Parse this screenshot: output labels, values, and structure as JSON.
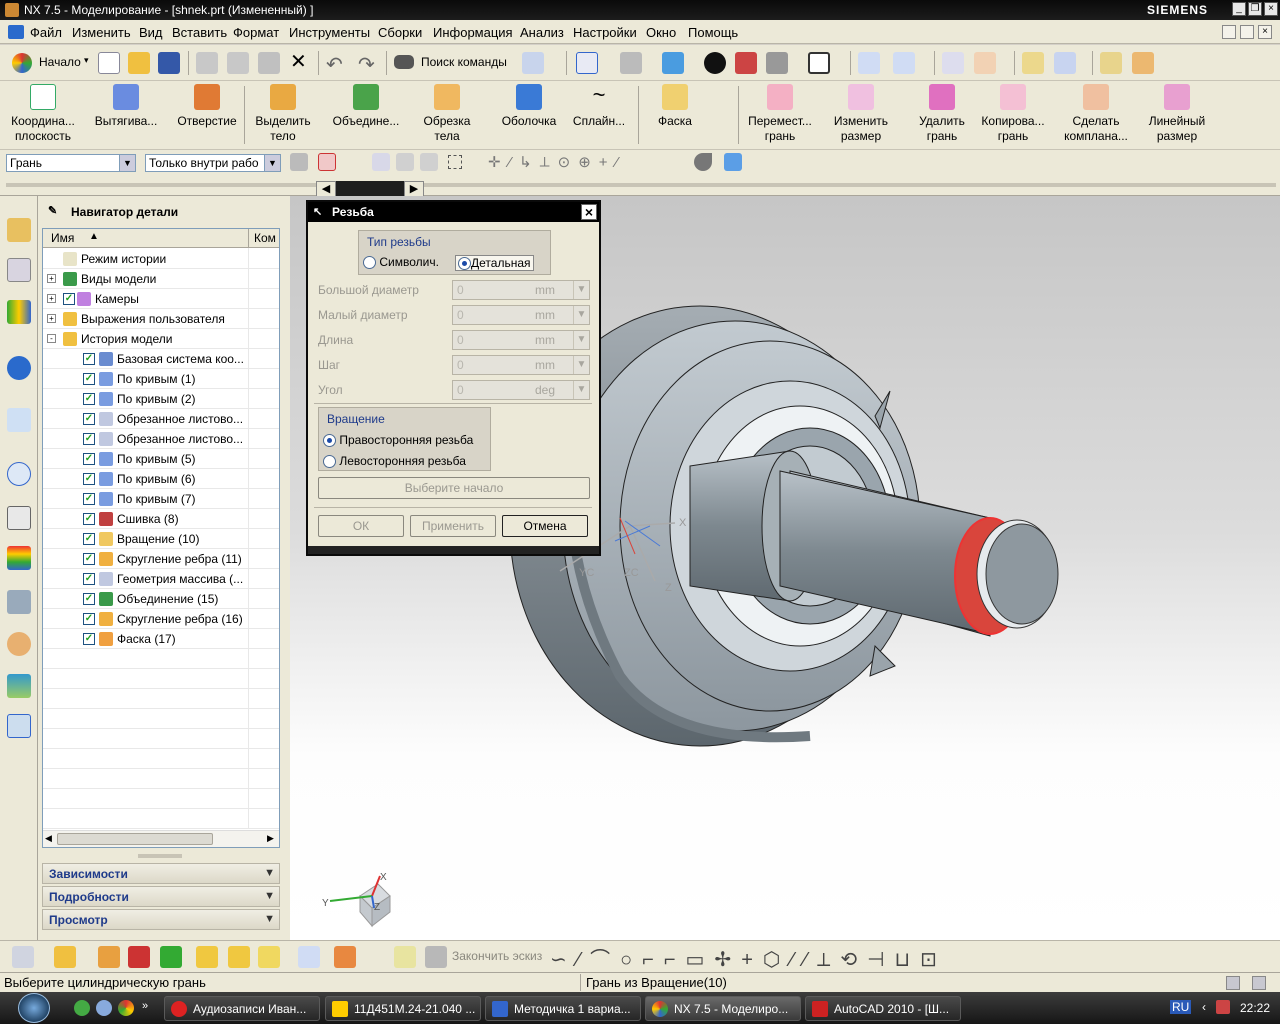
{
  "window": {
    "title": "NX 7.5 - Моделирование - [shnek.prt (Измененный) ]",
    "brand": "SIEMENS"
  },
  "menu": [
    "Файл",
    "Изменить",
    "Вид",
    "Вставить",
    "Формат",
    "Инструменты",
    "Сборки",
    "Информация",
    "Анализ",
    "Настройки",
    "Окно",
    "Помощь"
  ],
  "toolbar1": {
    "start_label": "Начало",
    "search_label": "Поиск команды"
  },
  "toolbar2": [
    {
      "label1": "Координа...",
      "label2": "плоскость"
    },
    {
      "label1": "Вытягива...",
      "label2": ""
    },
    {
      "label1": "Отверстие",
      "label2": ""
    },
    {
      "label1": "Выделить",
      "label2": "тело"
    },
    {
      "label1": "Объедине...",
      "label2": ""
    },
    {
      "label1": "Обрезка",
      "label2": "тела"
    },
    {
      "label1": "Оболочка",
      "label2": ""
    },
    {
      "label1": "Сплайн...",
      "label2": ""
    },
    {
      "label1": "Фаска",
      "label2": ""
    },
    {
      "label1": "Перемест...",
      "label2": "грань"
    },
    {
      "label1": "Изменить",
      "label2": "размер"
    },
    {
      "label1": "Удалить",
      "label2": "грань"
    },
    {
      "label1": "Копирова...",
      "label2": "грань"
    },
    {
      "label1": "Сделать",
      "label2": "комплана..."
    },
    {
      "label1": "Линейный",
      "label2": "размер"
    }
  ],
  "filters": {
    "type_filter": "Грань",
    "scope_filter": "Только внутри рабо"
  },
  "navigator": {
    "title": "Навигатор детали",
    "col_name": "Имя",
    "col_comment": "Ком",
    "items": [
      {
        "label": "Режим истории",
        "indent": 1,
        "check": false,
        "expand": ""
      },
      {
        "label": "Виды модели",
        "indent": 1,
        "check": false,
        "expand": "+"
      },
      {
        "label": "Камеры",
        "indent": 1,
        "check": true,
        "expand": "+"
      },
      {
        "label": "Выражения пользователя",
        "indent": 1,
        "check": false,
        "expand": "+"
      },
      {
        "label": "История модели",
        "indent": 1,
        "check": false,
        "expand": "-"
      },
      {
        "label": "Базовая система коо...",
        "indent": 2,
        "check": true,
        "expand": ""
      },
      {
        "label": "По кривым (1)",
        "indent": 2,
        "check": true,
        "expand": ""
      },
      {
        "label": "По кривым (2)",
        "indent": 2,
        "check": true,
        "expand": ""
      },
      {
        "label": "Обрезанное листово...",
        "indent": 2,
        "check": true,
        "expand": ""
      },
      {
        "label": "Обрезанное листово...",
        "indent": 2,
        "check": true,
        "expand": ""
      },
      {
        "label": "По кривым (5)",
        "indent": 2,
        "check": true,
        "expand": ""
      },
      {
        "label": "По кривым (6)",
        "indent": 2,
        "check": true,
        "expand": ""
      },
      {
        "label": "По кривым (7)",
        "indent": 2,
        "check": true,
        "expand": ""
      },
      {
        "label": "Сшивка (8)",
        "indent": 2,
        "check": true,
        "expand": ""
      },
      {
        "label": "Вращение (10)",
        "indent": 2,
        "check": true,
        "expand": ""
      },
      {
        "label": "Скругление ребра (11)",
        "indent": 2,
        "check": true,
        "expand": ""
      },
      {
        "label": "Геометрия массива (...",
        "indent": 2,
        "check": true,
        "expand": ""
      },
      {
        "label": "Объединение (15)",
        "indent": 2,
        "check": true,
        "expand": ""
      },
      {
        "label": "Скругление ребра (16)",
        "indent": 2,
        "check": true,
        "expand": ""
      },
      {
        "label": "Фаска (17)",
        "indent": 2,
        "check": true,
        "expand": ""
      }
    ],
    "panels": [
      "Зависимости",
      "Подробности",
      "Просмотр"
    ]
  },
  "dialog": {
    "title": "Резьба",
    "thread_type_group": "Тип резьбы",
    "opt_symbolic": "Символич.",
    "opt_detailed": "Детальная",
    "fields": [
      {
        "label": "Большой диаметр",
        "value": "0",
        "unit": "mm"
      },
      {
        "label": "Малый диаметр",
        "value": "0",
        "unit": "mm"
      },
      {
        "label": "Длина",
        "value": "0",
        "unit": "mm"
      },
      {
        "label": "Шаг",
        "value": "0",
        "unit": "mm"
      },
      {
        "label": "Угол",
        "value": "0",
        "unit": "deg"
      }
    ],
    "rotation_group": "Вращение",
    "opt_right": "Правосторонняя резьба",
    "opt_left": "Левосторонняя резьба",
    "select_start": "Выберите начало",
    "ok": "ОК",
    "apply": "Применить",
    "cancel": "Отмена"
  },
  "viewport": {
    "axis_x": "X",
    "axis_y": "Y",
    "axis_z": "Z",
    "csys_x": "X",
    "csys_y": "YC",
    "csys_z": "ZC",
    "csys_zz": "Z"
  },
  "bottom_toolbar": {
    "finish_sketch": "Закончить эскиз"
  },
  "status": {
    "prompt": "Выберите цилиндрическую грань",
    "selection": "Грань из Вращение(10)"
  },
  "taskbar": {
    "tasks": [
      "Аудиозаписи Иван...",
      "11Д451М.24-21.040 ...",
      "Методичка 1 вариа...",
      "NX 7.5 - Моделиро...",
      "AutoCAD 2010 - [Ш..."
    ],
    "lang": "RU",
    "time": "22:22"
  },
  "colors": {
    "highlight_face": "#d9453c",
    "part": "#a7b2ba",
    "dialog_title": "#000000"
  }
}
